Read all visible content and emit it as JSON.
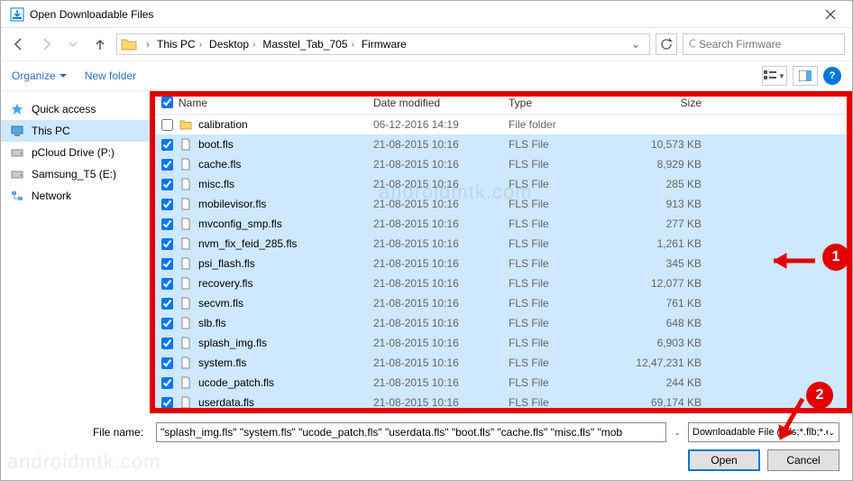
{
  "title": "Open Downloadable Files",
  "breadcrumbs": [
    "This PC",
    "Desktop",
    "Masstel_Tab_705",
    "Firmware"
  ],
  "search_placeholder": "Search Firmware",
  "toolbar": {
    "organize": "Organize",
    "new_folder": "New folder"
  },
  "navpane": [
    {
      "label": "Quick access",
      "icon": "star",
      "selected": false
    },
    {
      "label": "This PC",
      "icon": "pc",
      "selected": true
    },
    {
      "label": "pCloud Drive (P:)",
      "icon": "drive",
      "selected": false
    },
    {
      "label": "Samsung_T5 (E:)",
      "icon": "drive",
      "selected": false
    },
    {
      "label": "Network",
      "icon": "net",
      "selected": false
    }
  ],
  "columns": {
    "name": "Name",
    "date": "Date modified",
    "type": "Type",
    "size": "Size"
  },
  "rows": [
    {
      "checked": false,
      "icon": "folder",
      "name": "calibration",
      "date": "06-12-2016 14:19",
      "type": "File folder",
      "size": "",
      "sel": false
    },
    {
      "checked": true,
      "icon": "file",
      "name": "boot.fls",
      "date": "21-08-2015 10:16",
      "type": "FLS File",
      "size": "10,573 KB",
      "sel": true
    },
    {
      "checked": true,
      "icon": "file",
      "name": "cache.fls",
      "date": "21-08-2015 10:16",
      "type": "FLS File",
      "size": "8,929 KB",
      "sel": true
    },
    {
      "checked": true,
      "icon": "file",
      "name": "misc.fls",
      "date": "21-08-2015 10:16",
      "type": "FLS File",
      "size": "285 KB",
      "sel": true
    },
    {
      "checked": true,
      "icon": "file",
      "name": "mobilevisor.fls",
      "date": "21-08-2015 10:16",
      "type": "FLS File",
      "size": "913 KB",
      "sel": true
    },
    {
      "checked": true,
      "icon": "file",
      "name": "mvconfig_smp.fls",
      "date": "21-08-2015 10:16",
      "type": "FLS File",
      "size": "277 KB",
      "sel": true
    },
    {
      "checked": true,
      "icon": "file",
      "name": "nvm_fix_feid_285.fls",
      "date": "21-08-2015 10:16",
      "type": "FLS File",
      "size": "1,261 KB",
      "sel": true
    },
    {
      "checked": true,
      "icon": "file",
      "name": "psi_flash.fls",
      "date": "21-08-2015 10:16",
      "type": "FLS File",
      "size": "345 KB",
      "sel": true
    },
    {
      "checked": true,
      "icon": "file",
      "name": "recovery.fls",
      "date": "21-08-2015 10:16",
      "type": "FLS File",
      "size": "12,077 KB",
      "sel": true
    },
    {
      "checked": true,
      "icon": "file",
      "name": "secvm.fls",
      "date": "21-08-2015 10:16",
      "type": "FLS File",
      "size": "761 KB",
      "sel": true
    },
    {
      "checked": true,
      "icon": "file",
      "name": "slb.fls",
      "date": "21-08-2015 10:16",
      "type": "FLS File",
      "size": "648 KB",
      "sel": true
    },
    {
      "checked": true,
      "icon": "file",
      "name": "splash_img.fls",
      "date": "21-08-2015 10:16",
      "type": "FLS File",
      "size": "6,903 KB",
      "sel": true
    },
    {
      "checked": true,
      "icon": "file",
      "name": "system.fls",
      "date": "21-08-2015 10:16",
      "type": "FLS File",
      "size": "12,47,231 KB",
      "sel": true
    },
    {
      "checked": true,
      "icon": "file",
      "name": "ucode_patch.fls",
      "date": "21-08-2015 10:16",
      "type": "FLS File",
      "size": "244 KB",
      "sel": true
    },
    {
      "checked": true,
      "icon": "file",
      "name": "userdata.fls",
      "date": "21-08-2015 10:16",
      "type": "FLS File",
      "size": "69,174 KB",
      "sel": true
    }
  ],
  "footer": {
    "label": "File name:",
    "value": "\"splash_img.fls\" \"system.fls\" \"ucode_patch.fls\" \"userdata.fls\" \"boot.fls\" \"cache.fls\" \"misc.fls\" \"mob",
    "filter": "Downloadable File (*.fls;*.flb;*.e",
    "open": "Open",
    "cancel": "Cancel"
  },
  "watermark": "androidmtk.com",
  "annot": {
    "one": "1",
    "two": "2"
  }
}
